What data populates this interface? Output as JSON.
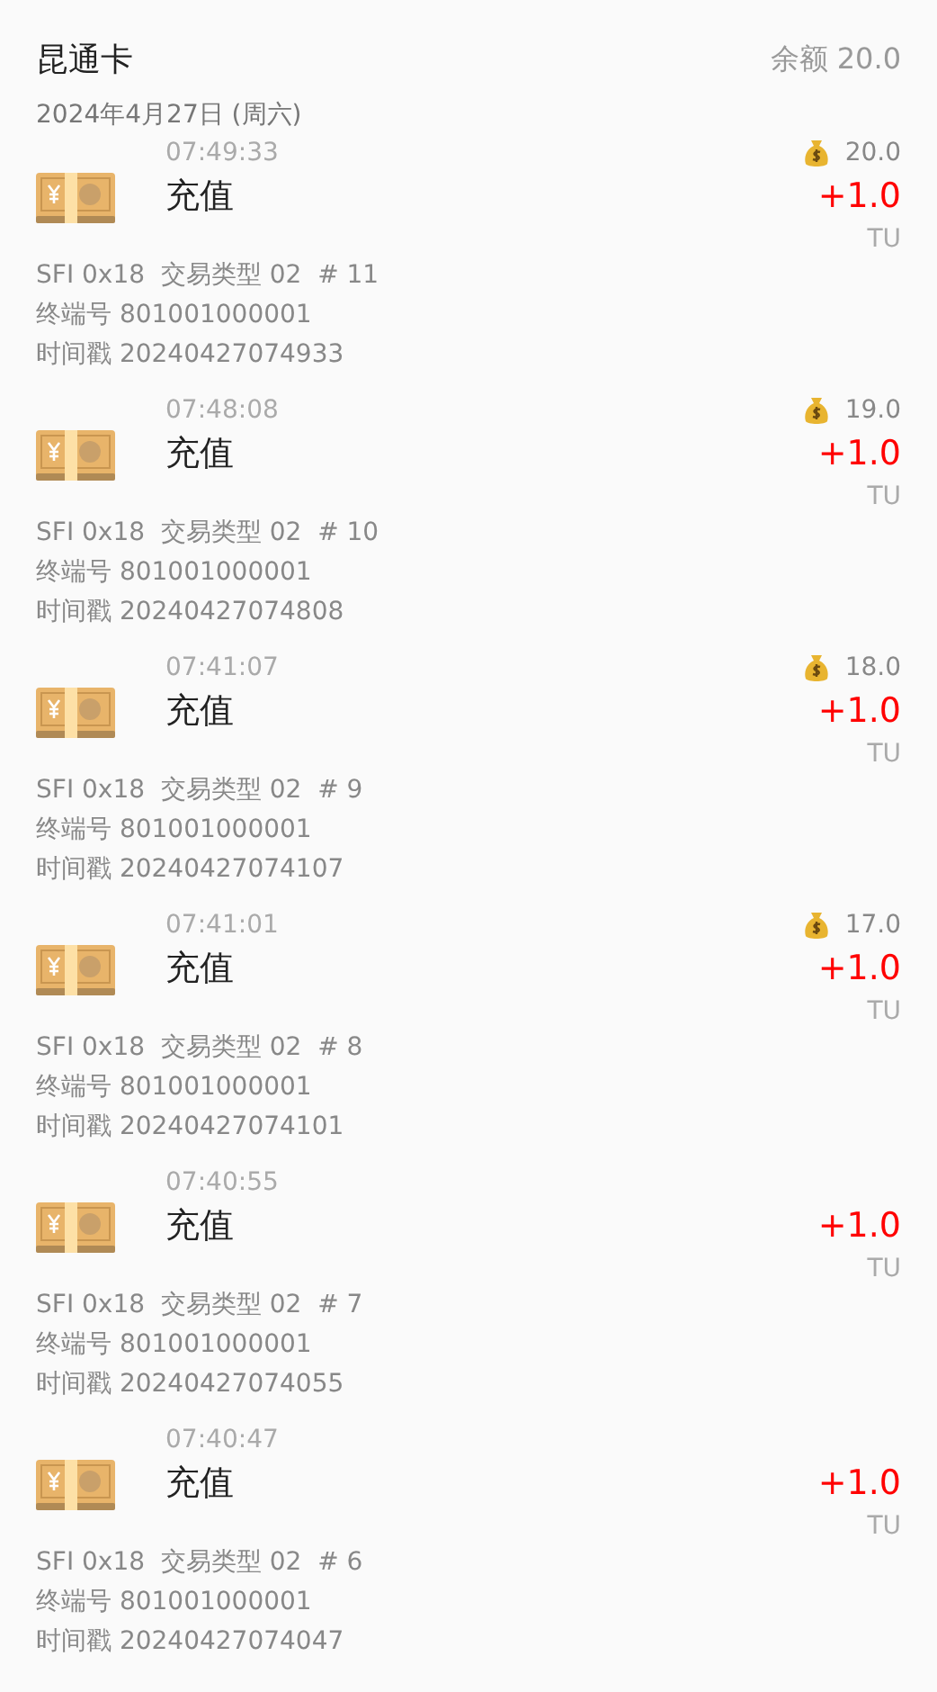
{
  "header": {
    "title": "昆通卡",
    "balance": "余额 20.0"
  },
  "date": "2024年4月27日 (周六)",
  "records": [
    {
      "time": "07:49:33",
      "title": "充值",
      "balance": "20.0",
      "amount": "+1.0",
      "unit": "TU",
      "info": [
        "SFI 0x18  交易类型 02  # 11",
        "终端号 801001000001",
        "时间戳 20240427074933"
      ]
    },
    {
      "time": "07:48:08",
      "title": "充值",
      "balance": "19.0",
      "amount": "+1.0",
      "unit": "TU",
      "info": [
        "SFI 0x18  交易类型 02  # 10",
        "终端号 801001000001",
        "时间戳 20240427074808"
      ]
    },
    {
      "time": "07:41:07",
      "title": "充值",
      "balance": "18.0",
      "amount": "+1.0",
      "unit": "TU",
      "info": [
        "SFI 0x18  交易类型 02  # 9",
        "终端号 801001000001",
        "时间戳 20240427074107"
      ]
    },
    {
      "time": "07:41:01",
      "title": "充值",
      "balance": "17.0",
      "amount": "+1.0",
      "unit": "TU",
      "info": [
        "SFI 0x18  交易类型 02  # 8",
        "终端号 801001000001",
        "时间戳 20240427074101"
      ]
    },
    {
      "time": "07:40:55",
      "title": "充值",
      "amount": "+1.0",
      "unit": "TU",
      "info": [
        "SFI 0x18  交易类型 02  # 7",
        "终端号 801001000001",
        "时间戳 20240427074055"
      ]
    },
    {
      "time": "07:40:47",
      "title": "充值",
      "amount": "+1.0",
      "unit": "TU",
      "info": [
        "SFI 0x18  交易类型 02  # 6",
        "终端号 801001000001",
        "时间戳 20240427074047"
      ]
    }
  ]
}
